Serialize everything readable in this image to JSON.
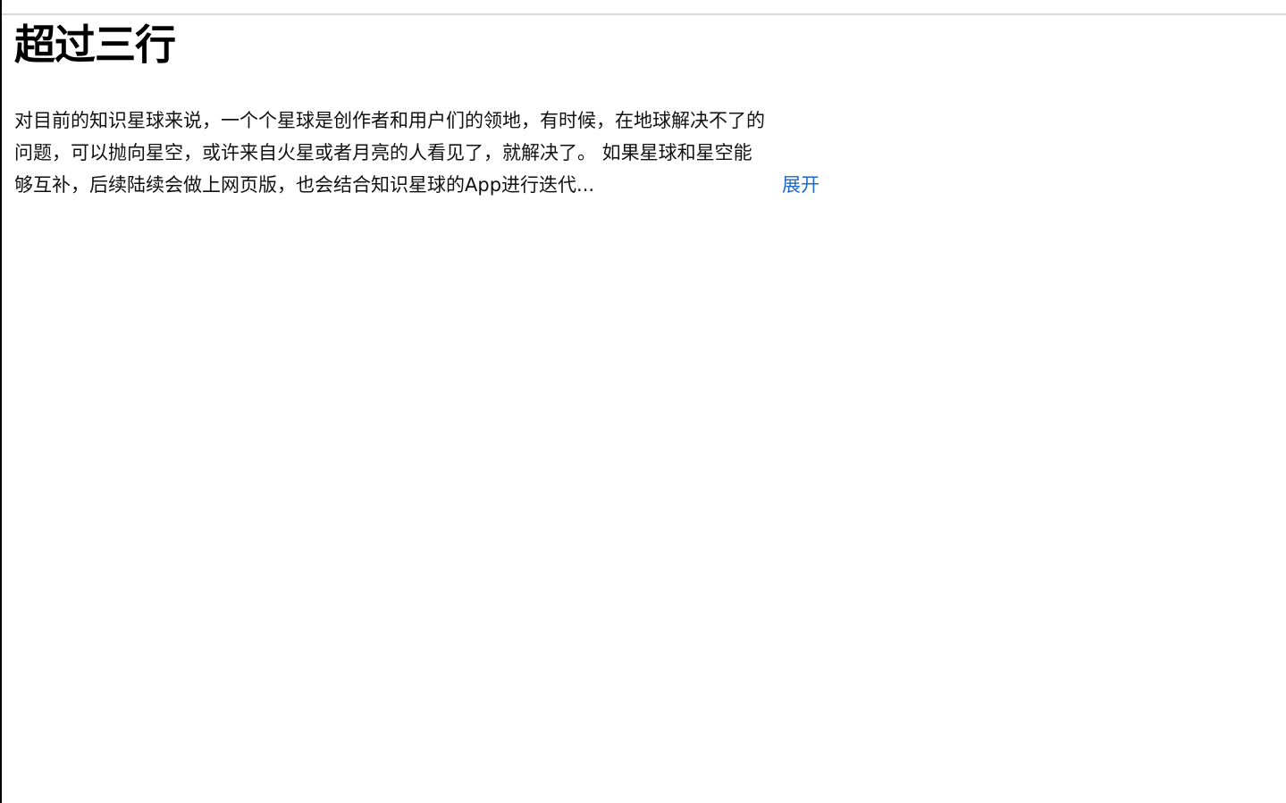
{
  "page": {
    "title": "超过三行"
  },
  "article": {
    "summary_text": "对目前的知识星球来说，一个个星球是创作者和用户们的领地，有时候，在地球解决不了的问题，可以抛向星空，或许来自火星或者月亮的人看见了，就解决了。 如果星球和星空能够互补，后续陆续会做上网页版，也会结合知识星球的App进行迭代...",
    "expand_label": "展开",
    "link_color": "#1e66d0"
  }
}
